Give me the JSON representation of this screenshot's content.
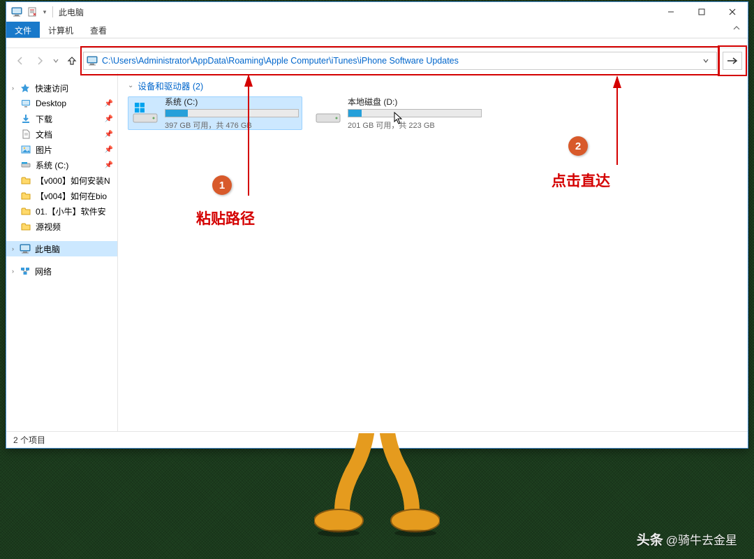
{
  "window": {
    "title": "此电脑",
    "sys": {
      "min": "—",
      "max": "☐",
      "close": "✕"
    }
  },
  "ribbon": {
    "file": "文件",
    "computer": "计算机",
    "view": "查看"
  },
  "nav": {
    "address_value": "C:\\Users\\Administrator\\AppData\\Roaming\\Apple Computer\\iTunes\\iPhone Software Updates"
  },
  "sidebar": {
    "quick": {
      "label": "快速访问"
    },
    "items": [
      {
        "label": "Desktop",
        "icon": "desktop",
        "pinned": true
      },
      {
        "label": "下载",
        "icon": "download",
        "pinned": true
      },
      {
        "label": "文档",
        "icon": "document",
        "pinned": true
      },
      {
        "label": "图片",
        "icon": "pictures",
        "pinned": true
      },
      {
        "label": "系统 (C:)",
        "icon": "drive",
        "pinned": true
      },
      {
        "label": "【v000】如何安装N",
        "icon": "folder",
        "pinned": false
      },
      {
        "label": "【v004】如何在bio",
        "icon": "folder",
        "pinned": false
      },
      {
        "label": "01.【小牛】软件安",
        "icon": "folder",
        "pinned": false
      },
      {
        "label": "源视频",
        "icon": "folder",
        "pinned": false
      }
    ],
    "thispc": {
      "label": "此电脑"
    },
    "network": {
      "label": "网络"
    }
  },
  "content": {
    "section_label": "设备和驱动器 (2)",
    "drives": [
      {
        "name": "系统 (C:)",
        "info": "397 GB 可用，共 476 GB",
        "fill_pct": 17,
        "selected": true,
        "tag": "windows"
      },
      {
        "name": "本地磁盘 (D:)",
        "info": "201 GB 可用，共 223 GB",
        "fill_pct": 10,
        "selected": false,
        "tag": ""
      }
    ]
  },
  "statusbar": {
    "text": "2 个项目"
  },
  "annotations": {
    "badge1": "1",
    "label1": "粘贴路径",
    "badge2": "2",
    "label2": "点击直达"
  },
  "watermark": {
    "brand": "头条",
    "handle": "@骑牛去金星"
  }
}
